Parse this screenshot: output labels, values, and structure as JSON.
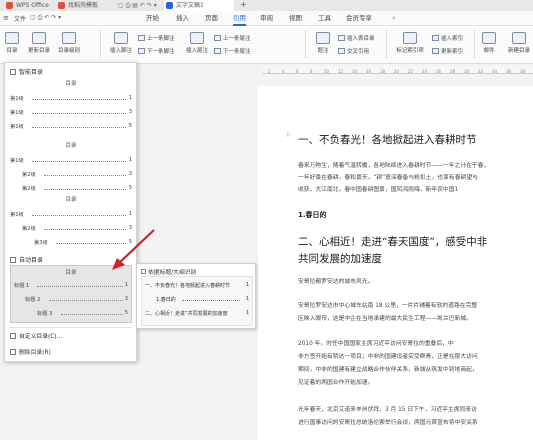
{
  "titlebar": {
    "tabs": [
      {
        "label": "WPS Office",
        "color": "#e0503b"
      },
      {
        "label": "找稻壳模板",
        "color": "#e0503b"
      },
      {
        "label": "文字文稿1",
        "color": "#2b63d8"
      }
    ],
    "new_tab": "+"
  },
  "menubar": {
    "items": [
      "开始",
      "插入",
      "页面",
      "引用",
      "审阅",
      "视图",
      "工具",
      "会员专享"
    ],
    "active": "引用"
  },
  "ribbon": {
    "toc": "目录",
    "update_toc": "更新目录",
    "toc_level": "目录级别",
    "insert_footnote": "插入脚注",
    "prev_footnote": "上一条脚注",
    "next_footnote": "下一条脚注",
    "insert_endnote": "插入尾注",
    "prev_endnote": "上一条尾注",
    "next_endnote": "下一条尾注",
    "caption": "题注",
    "insert_table_of_figures": "插入表目录",
    "cross_ref": "交叉引用",
    "mark_index": "标记索引项",
    "insert_index": "插入索引",
    "update_index": "更新索引",
    "mail": "邮件",
    "rebuild_toc": "新建目录"
  },
  "dropdown": {
    "smart_toc": "智能目录",
    "toc_title": "目录",
    "toc1": [
      {
        "label": "第1级",
        "page": "1"
      },
      {
        "label": "第1级",
        "page": "3"
      },
      {
        "label": "第1级",
        "page": "5"
      }
    ],
    "toc2": [
      {
        "label": "第1级",
        "page": "1"
      },
      {
        "label": "第2级",
        "page": "3"
      },
      {
        "label": "第2级",
        "page": "5"
      }
    ],
    "toc3": [
      {
        "label": "第1级",
        "page": "1"
      },
      {
        "label": "第2级",
        "page": "3"
      },
      {
        "label": "第3级",
        "page": "5"
      }
    ],
    "auto_toc": "自动目录",
    "toc4": [
      {
        "label": "标题 1",
        "page": "1"
      },
      {
        "label": "标题 2",
        "page": "3"
      },
      {
        "label": "标题 3",
        "page": "5"
      }
    ],
    "custom_toc": "自定义目录(C)...",
    "delete_toc": "删除目录(R)"
  },
  "tooltip": {
    "title": "依据标题/大纲识别",
    "rows": [
      {
        "label": "一、不负春光！各地掀起进入春耕时节",
        "page": "1"
      },
      {
        "label": "1.春日的",
        "page": "1"
      },
      {
        "label": "二、心相近！走进“共同发展的加速度",
        "page": "1"
      }
    ]
  },
  "document": {
    "h1": "一、不负春光！各地掀起进入春耕时节",
    "p1a": "春来万物生，随着气温转暖，各地陆续进入春耕时节——一年之计在于春，",
    "p1b": "一年好景在春耕。春和景天，“耕”意深春备与粉扣土，也享有春耕望与",
    "p1c": "收获。大江南北，春中国春耕图景，国风鸿雨嗨，新年农中国1",
    "sub1": "1.春日的",
    "h2a": "二、心相近！走进“春天国度”，感受中非",
    "h2b": "共同发展的加速度",
    "p2": "安哥拉都罗安达的城市风光。",
    "p3a": "安哥拉罗安达市中心城车站南 18 公里，一片片铺着有软的道路在完整",
    "p3b": "区映入眼帘，这是中企在当地承建的最大民生工程——凯兰巴新城。",
    "p4a": "2010 年，时任中国国家主席习近平访问安哥拉的重叠后，中",
    "p4b": "非方签开始有赞达一项目；中非的国建设者实受群青，正是在那大访问",
    "p4c": "期间，中非的国建有建立战略合作伙伴关系，新城从筑发中到地商起，",
    "p4d": "见证着的两国合作开始加速。",
    "p5a": "光年春天，北京艾诺来丰州伏拜，3 月 15 日下午，习近平主席同来访",
    "p5b": "进行国事访问的安哥拉总统洛伦索举行会谈，两国元首宣布将中安关系",
    "ruler_ticks": [
      "2",
      "4",
      "6",
      "8",
      "10",
      "12",
      "14",
      "16",
      "18",
      "20",
      "22",
      "24",
      "26",
      "28",
      "30",
      "32",
      "34",
      "36",
      "38"
    ]
  },
  "colors": {
    "accent": "#2b63d8",
    "arrow": "#d0222a"
  }
}
